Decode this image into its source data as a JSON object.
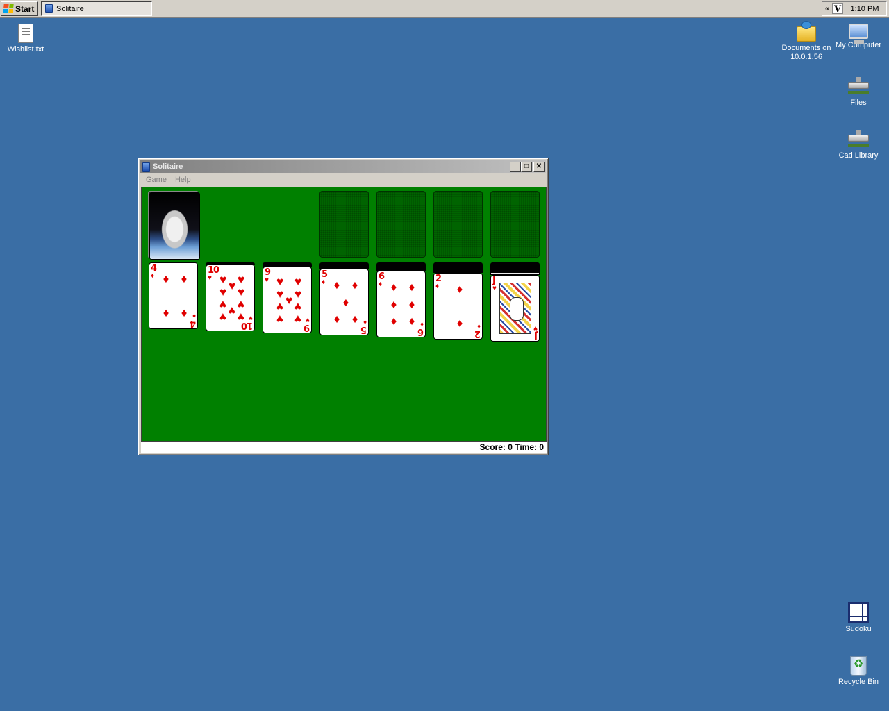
{
  "taskbar": {
    "start_label": "Start",
    "task_label": "Solitaire",
    "tray_chevron": "«",
    "tray_v": "V",
    "clock": "1:10 PM"
  },
  "desktop_icons": {
    "wishlist": "Wishlist.txt",
    "documents": "Documents on 10.0.1.56",
    "my_computer": "My Computer",
    "files": "Files",
    "cad_library": "Cad Library",
    "sudoku": "Sudoku",
    "recycle_bin": "Recycle Bin"
  },
  "window": {
    "title": "Solitaire",
    "menu": [
      "Game",
      "Help"
    ],
    "status": "Score: 0 Time: 0"
  },
  "tableau": [
    {
      "rank": "4",
      "suit": "♦",
      "color": "#e00000",
      "hidden_cards": 0
    },
    {
      "rank": "10",
      "suit": "♥",
      "color": "#e00000",
      "hidden_cards": 1
    },
    {
      "rank": "9",
      "suit": "♥",
      "color": "#e00000",
      "hidden_cards": 2
    },
    {
      "rank": "5",
      "suit": "♦",
      "color": "#e00000",
      "hidden_cards": 3
    },
    {
      "rank": "6",
      "suit": "♦",
      "color": "#e00000",
      "hidden_cards": 4
    },
    {
      "rank": "2",
      "suit": "♦",
      "color": "#e00000",
      "hidden_cards": 5
    },
    {
      "rank": "J",
      "suit": "♥",
      "color": "#e00000",
      "hidden_cards": 6
    }
  ]
}
